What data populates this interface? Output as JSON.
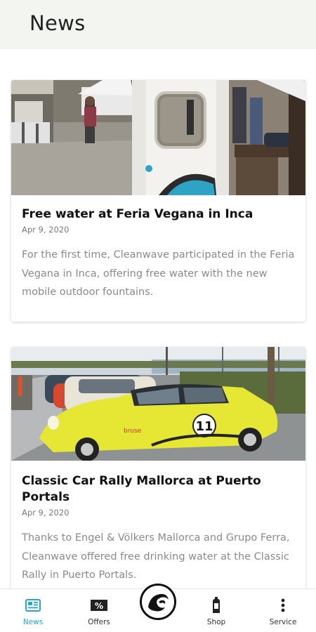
{
  "header": {
    "title": "News"
  },
  "articles": [
    {
      "title": "Free water at Feria Vegana in Inca",
      "date": "Apr 9, 2020",
      "text": "For the first time, Cleanwave participated in the Feria Vegana in Inca, offering free water with the new mobile outdoor fountains."
    },
    {
      "title": "Classic Car Rally Mallorca at Puerto Portals",
      "date": "Apr 9, 2020",
      "text": "Thanks to Engel & Völkers Mallorca and Grupo Ferra, Cleanwave offered free drinking water at the Classic Rally in Puerto Portals."
    }
  ],
  "tabs": [
    {
      "label": "News",
      "icon": "newspaper-icon",
      "active": true
    },
    {
      "label": "Offers",
      "icon": "percent-tag-icon",
      "active": false
    },
    {
      "label": "",
      "icon": "cleanwave-logo-icon",
      "active": false
    },
    {
      "label": "Shop",
      "icon": "bottle-icon",
      "active": false
    },
    {
      "label": "Service",
      "icon": "more-vertical-icon",
      "active": false
    }
  ],
  "colors": {
    "accent": "#2aa6c8",
    "header_bg": "#f3f5f0",
    "text_secondary": "#8a8a8a"
  }
}
